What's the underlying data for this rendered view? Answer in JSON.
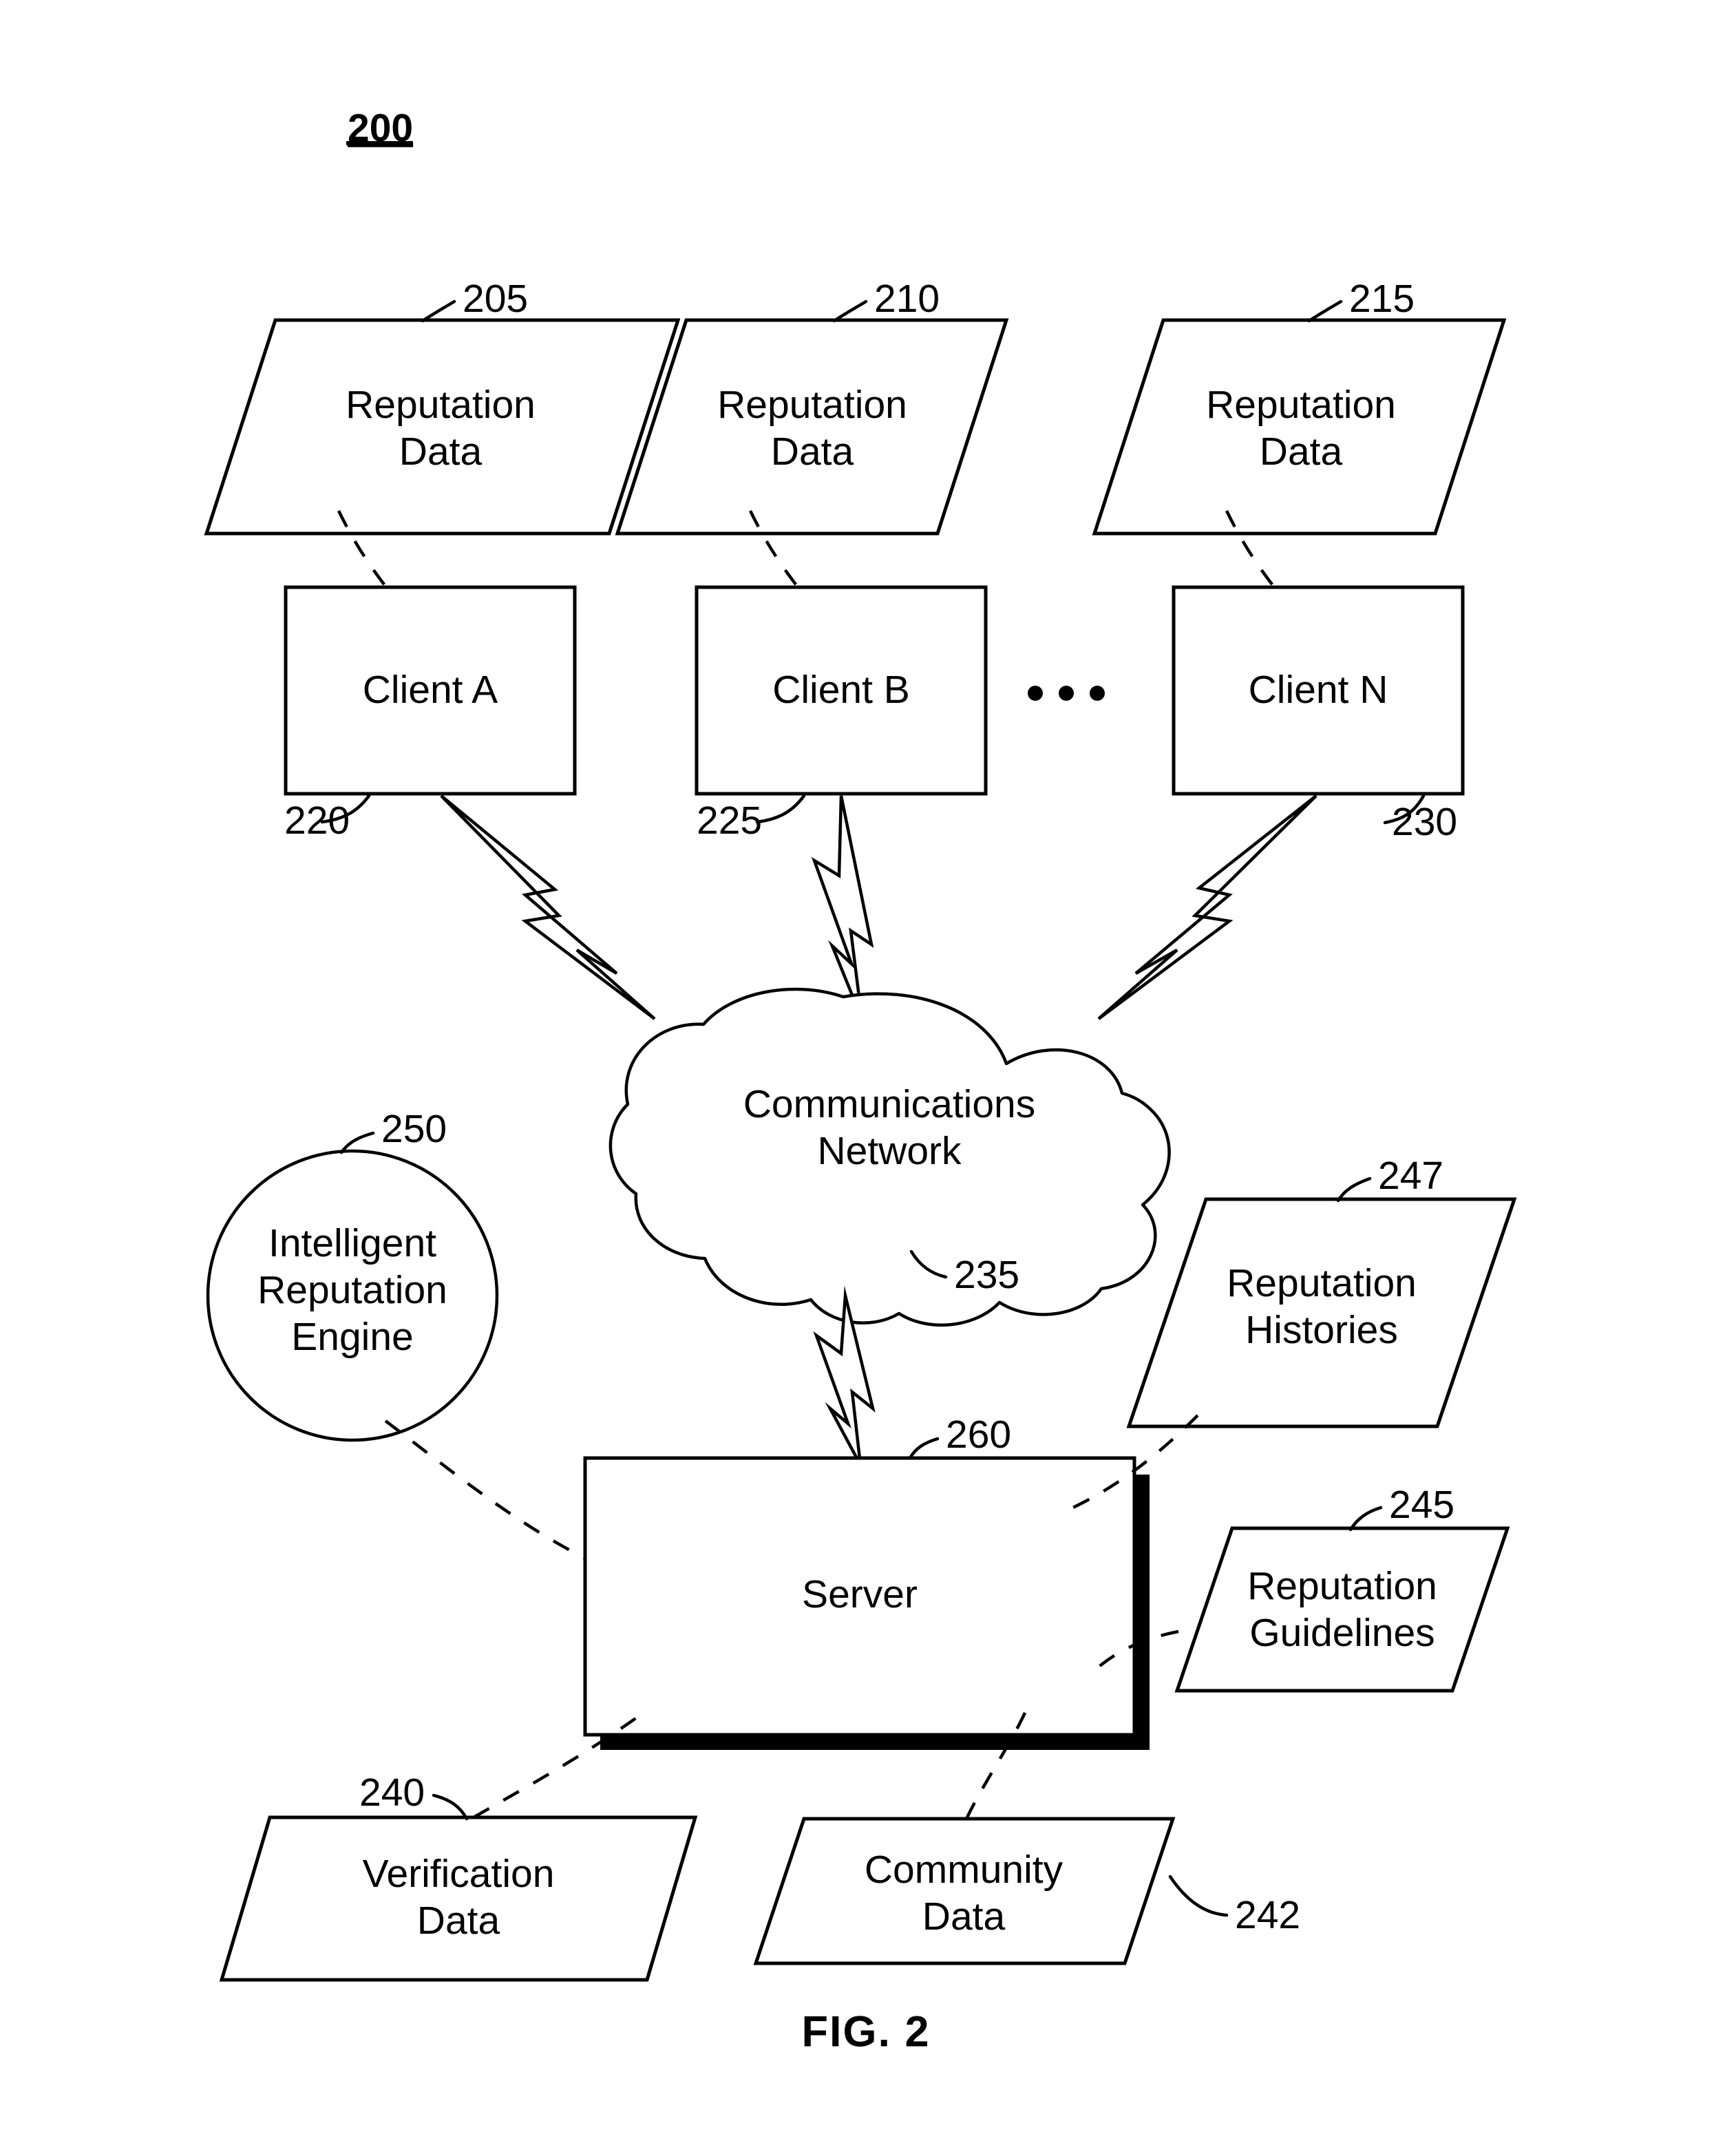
{
  "figure": {
    "number_label": "200",
    "caption": "FIG. 2"
  },
  "nodes": {
    "reputation_data_a": {
      "label_line1": "Reputation",
      "label_line2": "Data",
      "ref": "205"
    },
    "reputation_data_b": {
      "label_line1": "Reputation",
      "label_line2": "Data",
      "ref": "210"
    },
    "reputation_data_n": {
      "label_line1": "Reputation",
      "label_line2": "Data",
      "ref": "215"
    },
    "client_a": {
      "label": "Client A",
      "ref": "220"
    },
    "client_b": {
      "label": "Client B",
      "ref": "225"
    },
    "client_n": {
      "label": "Client N",
      "ref": "230"
    },
    "ellipsis": {
      "label": "• • •"
    },
    "communications_network": {
      "label_line1": "Communications",
      "label_line2": "Network",
      "ref": "235"
    },
    "intelligent_reputation_engine": {
      "label_line1": "Intelligent",
      "label_line2": "Reputation",
      "label_line3": "Engine",
      "ref": "250"
    },
    "server": {
      "label": "Server",
      "ref": "260"
    },
    "reputation_histories": {
      "label_line1": "Reputation",
      "label_line2": "Histories",
      "ref": "247"
    },
    "reputation_guidelines": {
      "label_line1": "Reputation",
      "label_line2": "Guidelines",
      "ref": "245"
    },
    "verification_data": {
      "label_line1": "Verification",
      "label_line2": "Data",
      "ref": "240"
    },
    "community_data": {
      "label_line1": "Community",
      "label_line2": "Data",
      "ref": "242"
    }
  },
  "colors": {
    "ink": "#000000",
    "paper": "#ffffff"
  }
}
